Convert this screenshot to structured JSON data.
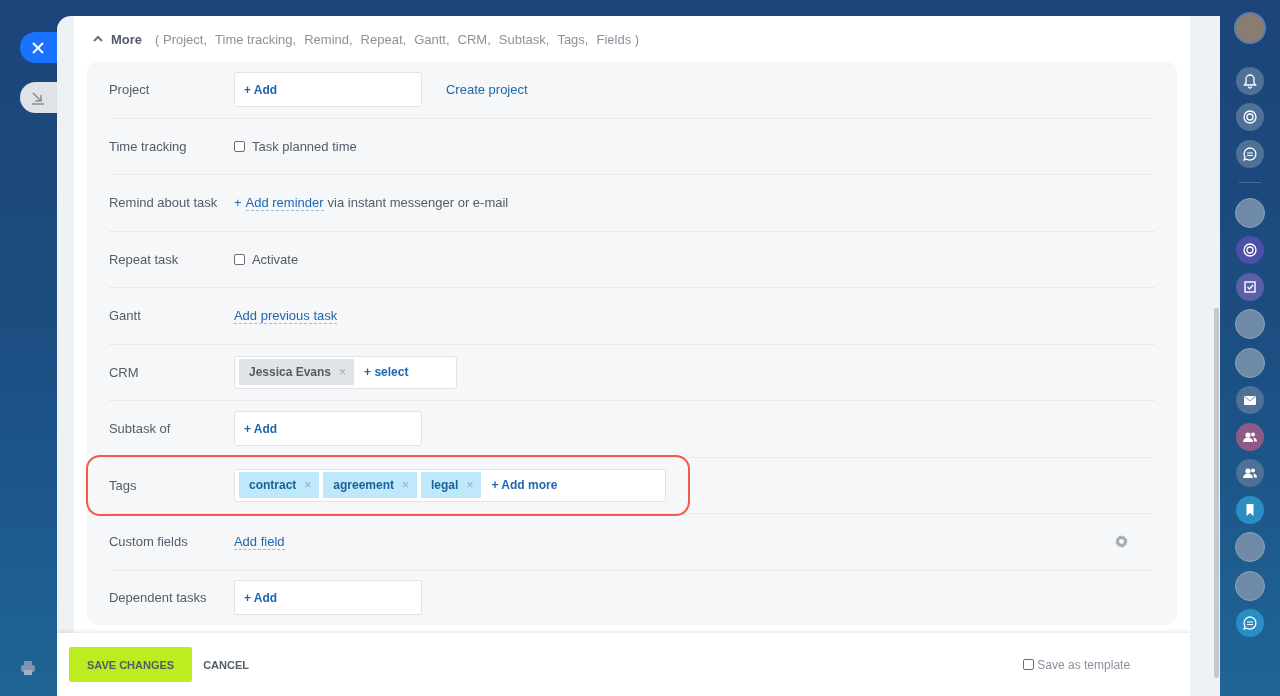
{
  "more": {
    "title": "More",
    "expanded": true,
    "summary": [
      "( Project,",
      "Time tracking,",
      "Remind,",
      "Repeat,",
      "Gantt,",
      "CRM,",
      "Subtask,",
      "Tags,",
      "Fields )"
    ]
  },
  "rows": [
    {
      "kind": "picker",
      "label": "Project",
      "add": "+ Add",
      "link": "Create project",
      "highlighted": false
    },
    {
      "kind": "checkbox",
      "label": "Time tracking",
      "option": "Task planned time",
      "checked": false,
      "highlighted": false
    },
    {
      "kind": "reminder",
      "label": "Remind about task",
      "plus": "+",
      "link": "Add reminder",
      "text": "via instant messenger or e-mail",
      "highlighted": false
    },
    {
      "kind": "checkbox",
      "label": "Repeat task",
      "option": "Activate",
      "checked": false,
      "highlighted": false
    },
    {
      "kind": "link",
      "label": "Gantt",
      "link": "Add previous task",
      "highlighted": false
    },
    {
      "kind": "entity-chips",
      "label": "CRM",
      "chips": [
        {
          "label": "Jessica Evans",
          "remove": "×"
        }
      ],
      "add": "+ select",
      "highlighted": false
    },
    {
      "kind": "picker",
      "label": "Subtask of",
      "add": "+ Add",
      "highlighted": false
    },
    {
      "kind": "tag-chips",
      "label": "Tags",
      "chips": [
        {
          "label": "contract",
          "remove": "×"
        },
        {
          "label": "agreement",
          "remove": "×"
        },
        {
          "label": "legal",
          "remove": "×"
        }
      ],
      "add": "+ Add more",
      "highlighted": true
    },
    {
      "kind": "link",
      "label": "Custom fields",
      "link": "Add field",
      "settings": true,
      "highlighted": false
    },
    {
      "kind": "picker",
      "label": "Dependent tasks",
      "add": "+ Add",
      "highlighted": false
    }
  ],
  "footer": {
    "save": "SAVE CHANGES",
    "cancel": "CANCEL",
    "template": {
      "label": "Save as template",
      "checked": false
    }
  }
}
